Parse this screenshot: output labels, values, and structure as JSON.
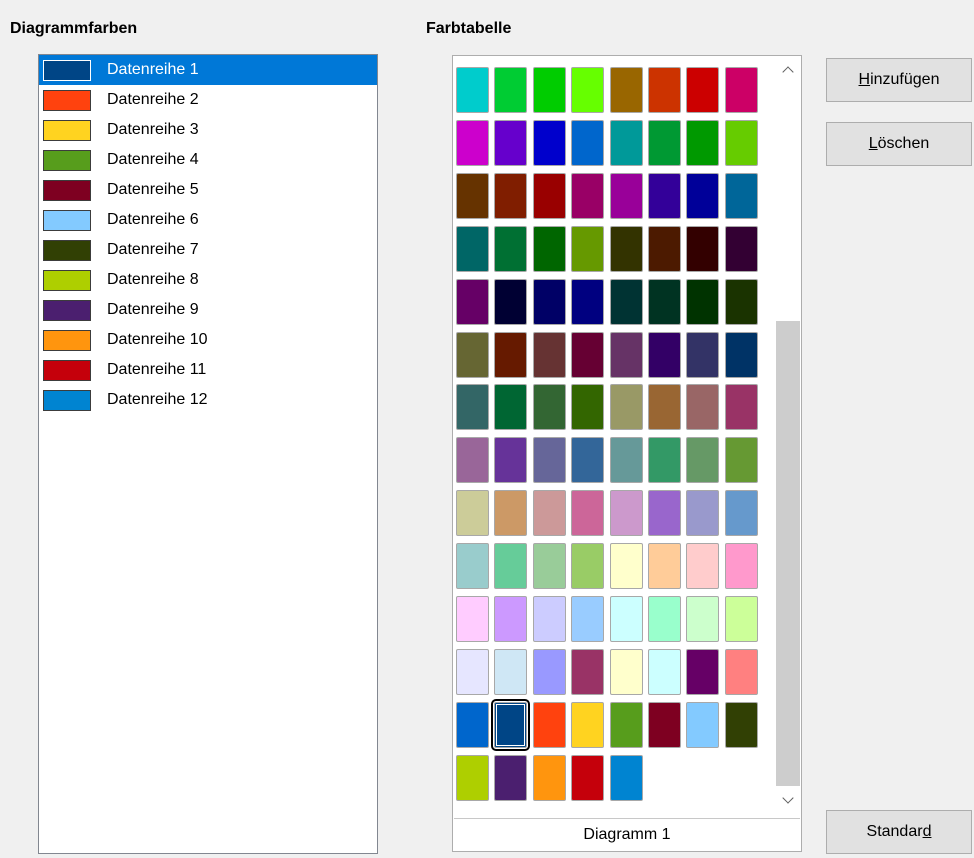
{
  "sections": {
    "chart_colors_title": "Diagrammfarben",
    "color_table_title": "Farbtabelle"
  },
  "series": [
    {
      "label": "Datenreihe 1",
      "color": "#004586",
      "selected": true
    },
    {
      "label": "Datenreihe 2",
      "color": "#ff420e"
    },
    {
      "label": "Datenreihe 3",
      "color": "#ffd320"
    },
    {
      "label": "Datenreihe 4",
      "color": "#579d1c"
    },
    {
      "label": "Datenreihe 5",
      "color": "#7e0021"
    },
    {
      "label": "Datenreihe 6",
      "color": "#83caff"
    },
    {
      "label": "Datenreihe 7",
      "color": "#314004"
    },
    {
      "label": "Datenreihe 8",
      "color": "#aecf00"
    },
    {
      "label": "Datenreihe 9",
      "color": "#4b1f6f"
    },
    {
      "label": "Datenreihe 10",
      "color": "#ff950e"
    },
    {
      "label": "Datenreihe 11",
      "color": "#c5000b"
    },
    {
      "label": "Datenreihe 12",
      "color": "#0084d1"
    }
  ],
  "palette": {
    "name": "Diagramm 1",
    "selected_index": 97,
    "colors": [
      "#00cccc",
      "#00cc33",
      "#00cc00",
      "#66ff00",
      "#996600",
      "#cc3300",
      "#cc0000",
      "#cc0066",
      "#cc00cc",
      "#6600cc",
      "#0000cc",
      "#0066cc",
      "#009999",
      "#009933",
      "#009900",
      "#66cc00",
      "#663300",
      "#801e00",
      "#990000",
      "#990066",
      "#990099",
      "#330099",
      "#000099",
      "#006699",
      "#006666",
      "#007033",
      "#006600",
      "#669900",
      "#333300",
      "#4c1a00",
      "#330000",
      "#330033",
      "#660066",
      "#000033",
      "#000066",
      "#000080",
      "#003333",
      "#003322",
      "#003300",
      "#1a3300",
      "#666633",
      "#661a00",
      "#663333",
      "#660033",
      "#663366",
      "#330066",
      "#333366",
      "#003366",
      "#336666",
      "#006633",
      "#336633",
      "#336600",
      "#999966",
      "#996633",
      "#996666",
      "#993366",
      "#996699",
      "#663399",
      "#666699",
      "#336699",
      "#669999",
      "#339966",
      "#669966",
      "#669933",
      "#cccc99",
      "#cc9966",
      "#cc9999",
      "#cc6699",
      "#cc99cc",
      "#9966cc",
      "#9999cc",
      "#6699cc",
      "#99cccc",
      "#66cc99",
      "#99cc99",
      "#99cc66",
      "#ffffcc",
      "#ffcc99",
      "#ffcccc",
      "#ff99cc",
      "#ffccff",
      "#cc99ff",
      "#ccccff",
      "#99ccff",
      "#ccffff",
      "#99ffcc",
      "#ccffcc",
      "#ccff99",
      "#e6e6ff",
      "#cfe7f5",
      "#9999ff",
      "#993366",
      "#ffffcc",
      "#ccffff",
      "#660066",
      "#ff8080",
      "#0066cc",
      "#004586",
      "#ff420e",
      "#ffd320",
      "#579d1c",
      "#7e0021",
      "#83caff",
      "#314004",
      "#aecf00",
      "#4b1f6f",
      "#ff950e",
      "#c5000b",
      "#0084d1"
    ]
  },
  "buttons": {
    "add": {
      "pre": "",
      "ul": "H",
      "post": "inzufügen"
    },
    "delete": {
      "pre": "",
      "ul": "L",
      "post": "öschen"
    },
    "standard": {
      "pre": "Standar",
      "ul": "d",
      "post": ""
    }
  }
}
